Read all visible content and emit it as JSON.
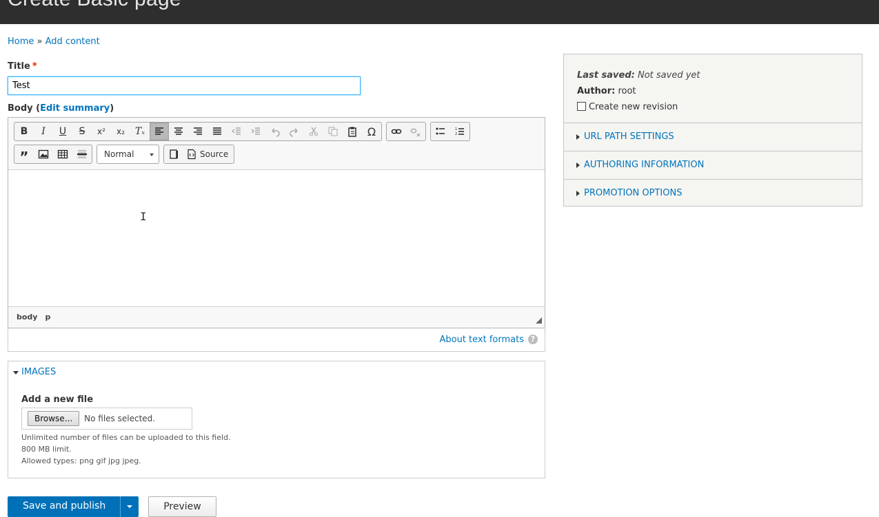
{
  "page": {
    "title": "Create Basic page"
  },
  "breadcrumb": {
    "home": "Home",
    "separator": "»",
    "add_content": "Add content"
  },
  "title_field": {
    "label": "Title",
    "required_marker": "*",
    "value": "Test"
  },
  "body_field": {
    "label": "Body",
    "open_paren": "(",
    "edit_summary": "Edit summary",
    "close_paren": ")"
  },
  "toolbar": {
    "format_value": "Normal",
    "source_label": "Source"
  },
  "editor": {
    "path": [
      "body",
      "p"
    ]
  },
  "about_formats": "About text formats",
  "images": {
    "section_title": "IMAGES",
    "add_label": "Add a new file",
    "browse_label": "Browse...",
    "no_files": "No files selected.",
    "desc_1": "Unlimited number of files can be uploaded to this field.",
    "desc_2": "800 MB limit.",
    "desc_3": "Allowed types: png gif jpg jpeg."
  },
  "actions": {
    "save_publish": "Save and publish",
    "preview": "Preview"
  },
  "sidebar": {
    "last_saved_label": "Last saved:",
    "last_saved_value": "Not saved yet",
    "author_label": "Author:",
    "author_value": "root",
    "revision_label": "Create new revision",
    "sections": [
      "URL PATH SETTINGS",
      "AUTHORING INFORMATION",
      "PROMOTION OPTIONS"
    ]
  },
  "colors": {
    "header_bg": "#2e2e2e",
    "link": "#0074bd",
    "primary": "#0071b8"
  }
}
